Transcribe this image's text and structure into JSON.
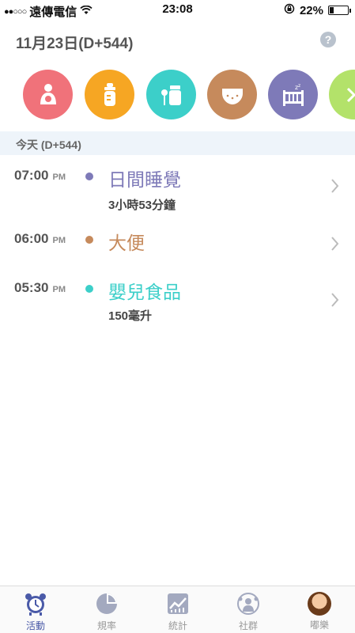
{
  "status_bar": {
    "signal": "●●○○○",
    "carrier": "遠傳電信",
    "time": "23:08",
    "battery": "22%",
    "battery_level": 0.22
  },
  "header": {
    "date": "11月23日(D+544)",
    "help_label": "?"
  },
  "categories": [
    {
      "name": "nursing",
      "icon": "nursing-icon",
      "color": "#f0727a"
    },
    {
      "name": "bottle",
      "icon": "bottle-icon",
      "color": "#f6a623"
    },
    {
      "name": "baby-food",
      "icon": "baby-food-icon",
      "color": "#3ccfc9"
    },
    {
      "name": "diaper",
      "icon": "diaper-icon",
      "color": "#c68a5c"
    },
    {
      "name": "sleep",
      "icon": "crib-icon",
      "color": "#7e7ab8"
    },
    {
      "name": "more",
      "icon": "more-icon",
      "color": "#b3e26a"
    }
  ],
  "section": {
    "label": "今天 (D+544)"
  },
  "log": [
    {
      "time": "07:00",
      "ampm": "PM",
      "title": "日間睡覺",
      "detail": "3小時53分鐘",
      "color": "#7e7ab8"
    },
    {
      "time": "06:00",
      "ampm": "PM",
      "title": "大便",
      "detail": "",
      "color": "#c68a5c"
    },
    {
      "time": "05:30",
      "ampm": "PM",
      "title": "嬰兒食品",
      "detail": "150毫升",
      "color": "#3ccfc9"
    }
  ],
  "tabs": [
    {
      "label": "活動",
      "icon": "alarm-clock-icon",
      "active": true
    },
    {
      "label": "規率",
      "icon": "pie-chart-icon",
      "active": false
    },
    {
      "label": "統計",
      "icon": "line-chart-icon",
      "active": false
    },
    {
      "label": "社群",
      "icon": "community-icon",
      "active": false
    },
    {
      "label": "嘟樂",
      "icon": "profile-avatar",
      "active": false
    }
  ]
}
